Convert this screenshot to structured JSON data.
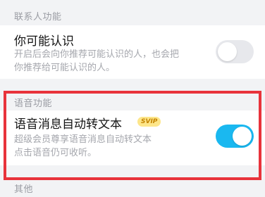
{
  "sections": [
    {
      "header": "联系人功能",
      "item": {
        "title": "你可能认识",
        "desc_line1": "开启后会向你推荐可能认识的人，也会把",
        "desc_line2": "你推荐给可能认识的人。",
        "toggle_state": "off"
      }
    },
    {
      "header": "语音功能",
      "item": {
        "title": "语音消息自动转文本",
        "badge": "SVIP",
        "desc_line1": "超级会员尊享语音消息自动转文本",
        "desc_line2": "点击语音仍可收听。",
        "toggle_state": "on"
      }
    },
    {
      "header": "其他"
    }
  ],
  "colors": {
    "toggle_on": "#1ab8f0",
    "toggle_off": "#e7e8ec",
    "highlight": "#e8333b",
    "badge_bg": "#fde68a"
  }
}
